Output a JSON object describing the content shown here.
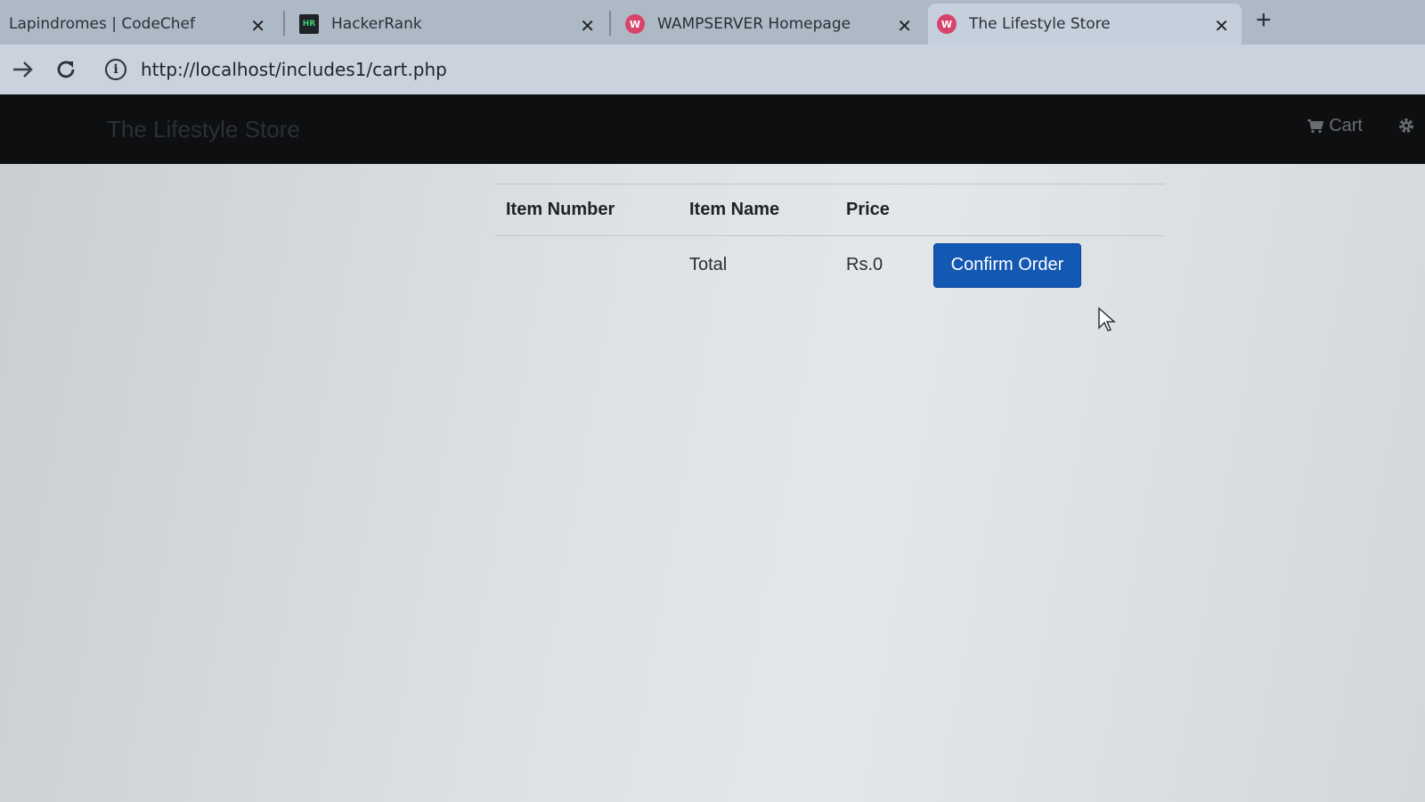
{
  "browser": {
    "tabs": [
      {
        "title": "Lapindromes | CodeChef",
        "favicon": "codechef-icon",
        "active": false
      },
      {
        "title": "HackerRank",
        "favicon": "hackerrank-icon",
        "active": false
      },
      {
        "title": "WAMPSERVER Homepage",
        "favicon": "wampserver-icon",
        "active": false
      },
      {
        "title": "The Lifestyle Store",
        "favicon": "wampserver-icon",
        "active": true
      }
    ],
    "hr_favicon_text": "HR",
    "wamp_favicon_text": "W",
    "close_glyph": "✕",
    "new_tab_glyph": "+",
    "url": "http://localhost/includes1/cart.php"
  },
  "navbar": {
    "brand": "The Lifestyle Store",
    "cart_label": "Cart"
  },
  "cart": {
    "headers": {
      "item_number": "Item Number",
      "item_name": "Item Name",
      "price": "Price"
    },
    "total_label": "Total",
    "total_value": "Rs.0",
    "confirm_label": "Confirm Order"
  },
  "colors": {
    "navbar_bg": "#0e0f10",
    "confirm_button": "#1358b3"
  }
}
